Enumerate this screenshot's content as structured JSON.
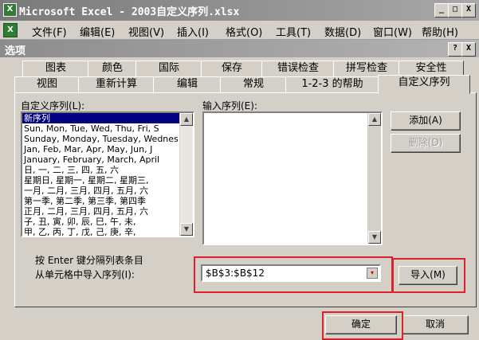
{
  "window": {
    "title": "Microsoft Excel - 2003自定义序列.xlsx",
    "app_icon": "X",
    "minimize": "_",
    "restore": "□",
    "close": "X"
  },
  "menubar": {
    "items": [
      "文件(F)",
      "编辑(E)",
      "视图(V)",
      "插入(I)",
      "格式(O)",
      "工具(T)",
      "数据(D)",
      "窗口(W)",
      "帮助(H)"
    ]
  },
  "dialog": {
    "title": "选项",
    "help": "?",
    "close": "X",
    "tabs_row1": [
      "图表",
      "颜色",
      "国际",
      "保存",
      "错误检查",
      "拼写检查",
      "安全性"
    ],
    "tabs_row2": [
      "视图",
      "重新计算",
      "编辑",
      "常规",
      "1-2-3 的帮助",
      "自定义序列"
    ],
    "active_tab": "自定义序列"
  },
  "custom_lists": {
    "label": "自定义序列(L):",
    "items": [
      "新序列",
      "Sun, Mon, Tue, Wed, Thu, Fri, S",
      "Sunday, Monday, Tuesday, Wednes",
      "Jan, Feb, Mar, Apr, May, Jun, J",
      "January, February, March, April",
      "日, 一, 二, 三, 四, 五, 六",
      "星期日, 星期一, 星期二, 星期三,",
      "一月, 二月, 三月, 四月, 五月, 六",
      "第一季, 第二季, 第三季, 第四季",
      "正月, 二月, 三月, 四月, 五月, 六",
      "子, 丑, 寅, 卯, 辰, 巳, 午, 未,",
      "甲, 乙, 丙, 丁, 戊, 己, 庚, 辛,"
    ],
    "selected": "新序列"
  },
  "input_list": {
    "label": "输入序列(E):",
    "value": ""
  },
  "buttons": {
    "add": "添加(A)",
    "delete": "删除(D)",
    "import": "导入(M)",
    "ok": "确定",
    "cancel": "取消"
  },
  "import_section": {
    "hint_line1": "按 Enter 键分隔列表条目",
    "hint_line2": "从单元格中导入序列(I):",
    "range_value": "$B$3:$B$12"
  },
  "highlight_color": "#e0202a"
}
